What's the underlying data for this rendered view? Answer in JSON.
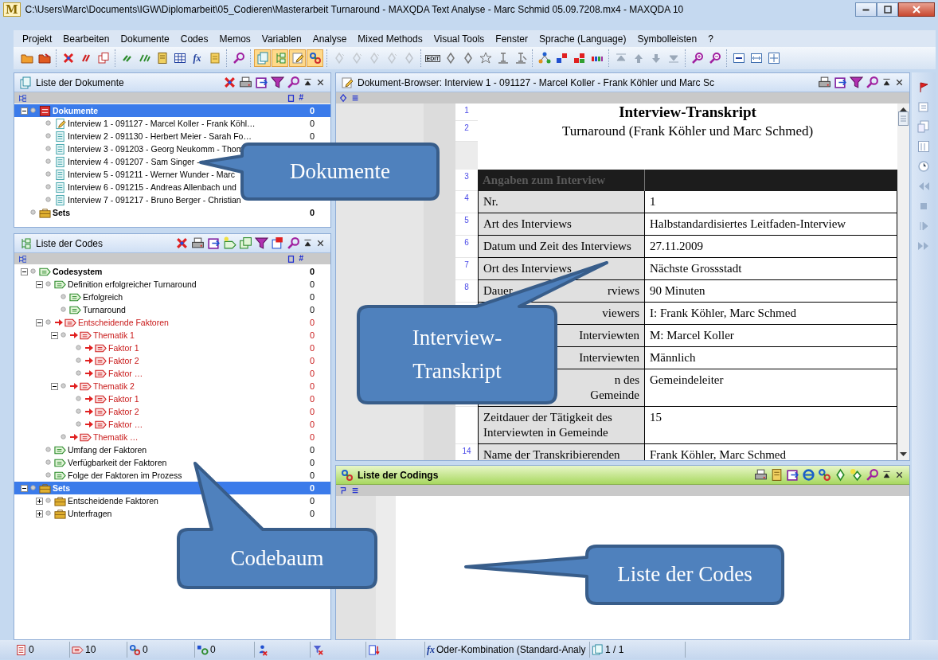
{
  "window": {
    "logo": "M",
    "title": "C:\\Users\\Marc\\Documents\\IGW\\Diplomarbeit\\05_Codieren\\Masterarbeit Turnaround - MAXQDA Text Analyse - Marc Schmid 05.09.7208.mx4 - MAXQDA 10"
  },
  "menu": [
    "Projekt",
    "Bearbeiten",
    "Dokumente",
    "Codes",
    "Memos",
    "Variablen",
    "Analyse",
    "Mixed Methods",
    "Visual Tools",
    "Fenster",
    "Sprache (Language)",
    "Symbolleisten",
    "?"
  ],
  "toolbar": [
    [
      {
        "kind": "icon",
        "on": false,
        "disabled": false
      },
      {
        "kind": "icon",
        "on": false,
        "disabled": false
      }
    ],
    [
      {
        "kind": "icon",
        "on": false,
        "disabled": false
      },
      {
        "kind": "icon",
        "on": false,
        "disabled": false
      },
      {
        "kind": "icon",
        "on": false,
        "disabled": false
      }
    ],
    [
      {
        "kind": "icon",
        "on": false,
        "disabled": false
      },
      {
        "kind": "icon",
        "on": false,
        "disabled": false
      },
      {
        "kind": "icon",
        "on": false,
        "disabled": false
      },
      {
        "kind": "icon",
        "on": false,
        "disabled": false
      },
      {
        "kind": "glyph",
        "glyph": "fx",
        "on": false,
        "disabled": false
      },
      {
        "kind": "icon",
        "on": false,
        "disabled": false
      }
    ],
    [
      {
        "kind": "icon",
        "on": false,
        "disabled": false
      }
    ],
    [
      {
        "kind": "icon",
        "on": true,
        "disabled": false
      },
      {
        "kind": "icon",
        "on": true,
        "disabled": false
      },
      {
        "kind": "icon",
        "on": true,
        "disabled": false
      },
      {
        "kind": "icon",
        "on": true,
        "disabled": false
      }
    ],
    [
      {
        "kind": "icon",
        "on": false,
        "disabled": true
      },
      {
        "kind": "icon",
        "on": false,
        "disabled": true
      },
      {
        "kind": "icon",
        "on": false,
        "disabled": true
      },
      {
        "kind": "icon",
        "on": false,
        "disabled": true
      },
      {
        "kind": "icon",
        "on": false,
        "disabled": true
      }
    ],
    [
      {
        "kind": "glyph",
        "glyph": "EDIT",
        "on": false,
        "disabled": false
      },
      {
        "kind": "icon",
        "on": false,
        "disabled": false
      },
      {
        "kind": "icon",
        "on": false,
        "disabled": false
      },
      {
        "kind": "icon",
        "on": false,
        "disabled": false
      },
      {
        "kind": "icon",
        "on": false,
        "disabled": false
      },
      {
        "kind": "icon",
        "on": false,
        "disabled": false
      }
    ],
    [
      {
        "kind": "icon",
        "on": false,
        "disabled": false
      },
      {
        "kind": "icon",
        "on": false,
        "disabled": false
      },
      {
        "kind": "icon",
        "on": false,
        "disabled": false
      },
      {
        "kind": "icon",
        "on": false,
        "disabled": false
      }
    ],
    [
      {
        "kind": "icon",
        "on": false,
        "disabled": false
      },
      {
        "kind": "icon",
        "on": false,
        "disabled": false
      },
      {
        "kind": "icon",
        "on": false,
        "disabled": false
      },
      {
        "kind": "icon",
        "on": false,
        "disabled": false
      }
    ],
    [
      {
        "kind": "icon",
        "on": false,
        "disabled": false
      },
      {
        "kind": "icon",
        "on": false,
        "disabled": false
      }
    ],
    [
      {
        "kind": "icon",
        "on": false,
        "disabled": false
      },
      {
        "kind": "icon",
        "on": false,
        "disabled": false
      },
      {
        "kind": "icon",
        "on": false,
        "disabled": false
      }
    ]
  ],
  "documents_panel": {
    "title": "Liste der Dokumente",
    "count_column": "#",
    "tree": [
      {
        "kind": "group",
        "label": "Dokumente",
        "count": "0",
        "selected": true,
        "expanded": true,
        "children": [
          {
            "kind": "document-edited",
            "label": "Interview 1 - 091127 - Marcel Koller - Frank Köhl…",
            "count": "0",
            "selected": false
          },
          {
            "kind": "document",
            "label": "Interview 2 - 091130 - Herbert Meier - Sarah Fo…",
            "count": "0",
            "selected": false
          },
          {
            "kind": "document",
            "label": "Interview 3 - 091203 - Georg Neukomm - Thom",
            "selected": false
          },
          {
            "kind": "document",
            "label": "Interview 4 - 091207 - Sam Singer -",
            "selected": false
          },
          {
            "kind": "document",
            "label": "Interview 5 - 091211 - Werner Wunder - Marc",
            "selected": false
          },
          {
            "kind": "document",
            "label": "Interview 6 - 091215 - Andreas Allenbach und",
            "selected": false
          },
          {
            "kind": "document",
            "label": "Interview 7 - 091217 - Bruno Berger - Christian",
            "selected": false
          }
        ]
      },
      {
        "kind": "set",
        "label": "Sets",
        "count": "0",
        "selected": false
      }
    ]
  },
  "codes_panel": {
    "title": "Liste der Codes",
    "count_column": "#",
    "tree": [
      {
        "kind": "code",
        "label": "Codesystem",
        "count": "0",
        "selected": false,
        "activated": false,
        "expanded": true,
        "children": [
          {
            "kind": "code",
            "label": "Definition erfolgreicher Turnaround",
            "count": "0",
            "selected": false,
            "activated": false,
            "expanded": true,
            "children": [
              {
                "kind": "code",
                "label": "Erfolgreich",
                "count": "0",
                "selected": false,
                "activated": false
              },
              {
                "kind": "code",
                "label": "Turnaround",
                "count": "0",
                "selected": false,
                "activated": false
              }
            ]
          },
          {
            "kind": "code",
            "label": "Entscheidende Faktoren",
            "count": "0",
            "selected": false,
            "activated": true,
            "expanded": true,
            "children": [
              {
                "kind": "code",
                "label": "Thematik 1",
                "count": "0",
                "selected": false,
                "activated": true,
                "expanded": true,
                "children": [
                  {
                    "kind": "code",
                    "label": "Faktor 1",
                    "count": "0",
                    "selected": false,
                    "activated": true
                  },
                  {
                    "kind": "code",
                    "label": "Faktor 2",
                    "count": "0",
                    "selected": false,
                    "activated": true
                  },
                  {
                    "kind": "code",
                    "label": "Faktor …",
                    "count": "0",
                    "selected": false,
                    "activated": true
                  }
                ]
              },
              {
                "kind": "code",
                "label": "Thematik 2",
                "count": "0",
                "selected": false,
                "activated": true,
                "expanded": true,
                "children": [
                  {
                    "kind": "code",
                    "label": "Faktor 1",
                    "count": "0",
                    "selected": false,
                    "activated": true
                  },
                  {
                    "kind": "code",
                    "label": "Faktor 2",
                    "count": "0",
                    "selected": false,
                    "activated": true
                  },
                  {
                    "kind": "code",
                    "label": "Faktor …",
                    "count": "0",
                    "selected": false,
                    "activated": true
                  }
                ]
              },
              {
                "kind": "code",
                "label": "Thematik …",
                "count": "0",
                "selected": false,
                "activated": true
              }
            ]
          },
          {
            "kind": "code",
            "label": "Umfang der Faktoren",
            "count": "0",
            "selected": false,
            "activated": false
          },
          {
            "kind": "code",
            "label": "Verfügbarkeit der Faktoren",
            "count": "0",
            "selected": false,
            "activated": false
          },
          {
            "kind": "code",
            "label": "Folge der Faktoren im Prozess",
            "count": "0",
            "selected": false,
            "activated": false
          }
        ]
      },
      {
        "kind": "set",
        "label": "Sets",
        "count": "0",
        "selected": true,
        "activated": false,
        "expanded": true,
        "children": [
          {
            "kind": "set",
            "label": "Entscheidende Faktoren",
            "count": "0",
            "selected": false,
            "activated": false,
            "expanded": false
          },
          {
            "kind": "set",
            "label": "Unterfragen",
            "count": "0",
            "selected": false,
            "activated": false,
            "expanded": false
          }
        ]
      }
    ]
  },
  "document_browser": {
    "title": "Dokument-Browser: Interview 1 - 091127 - Marcel Koller - Frank Köhler und Marc Sc",
    "heading": {
      "line": "1",
      "text": "Interview-Transkript"
    },
    "subheading": {
      "line": "2",
      "text": "Turnaround (Frank Köhler und Marc Schmed)"
    },
    "table_header": {
      "line": "3",
      "text": "Angaben zum Interview"
    },
    "rows": [
      {
        "line": "4",
        "label": [
          "Nr."
        ],
        "value": "1"
      },
      {
        "line": "5",
        "label": [
          "Art des Interviews"
        ],
        "value": "Halbstandardisiertes Leitfaden-Interview"
      },
      {
        "line": "6",
        "label": [
          "Datum und Zeit des Interviews"
        ],
        "value": "27.11.2009"
      },
      {
        "line": "7",
        "label": [
          "Ort des Interviews"
        ],
        "value": "Nächste Grossstadt"
      },
      {
        "line": "8",
        "label": [
          {
            "before": "Dauer",
            "after": "rviews"
          }
        ],
        "value": "90 Minuten"
      },
      {
        "label": [
          {
            "after": "viewers"
          }
        ],
        "value": "I: Frank Köhler, Marc Schmed"
      },
      {
        "label": [
          {
            "after": "Interviewten"
          }
        ],
        "value": "M: Marcel Koller"
      },
      {
        "label": [
          {
            "after": "Interviewten"
          }
        ],
        "value": "Männlich"
      },
      {
        "label": [
          {
            "after": "n des"
          },
          {
            "after": "Gemeinde"
          }
        ],
        "value": "Gemeindeleiter"
      },
      {
        "label": [
          "Zeitdauer der Tätigkeit des",
          "Interviewten in Gemeinde"
        ],
        "value": "15"
      },
      {
        "line": "14",
        "label": [
          "Name der Transkribierenden"
        ],
        "value": "Frank Köhler, Marc Schmed"
      }
    ]
  },
  "codings_panel": {
    "title": "Liste der Codings"
  },
  "status_bar": [
    {
      "kind": "documents",
      "text": "0"
    },
    {
      "kind": "codes",
      "text": "10"
    },
    {
      "kind": "codings",
      "text": "0"
    },
    {
      "kind": "variables",
      "text": "0"
    },
    {
      "kind": "person-off"
    },
    {
      "kind": "filter-off"
    },
    {
      "kind": "doc-arrow"
    },
    {
      "kind": "function",
      "glyph": "fx",
      "text": "Oder-Kombination (Standard-Analy"
    },
    {
      "kind": "pages",
      "text": "1 / 1"
    }
  ],
  "callouts": [
    {
      "text": "Dokumente"
    },
    {
      "text": "Interview-Transkript"
    },
    {
      "text": "Codebaum"
    },
    {
      "text": "Liste der Codes"
    }
  ]
}
